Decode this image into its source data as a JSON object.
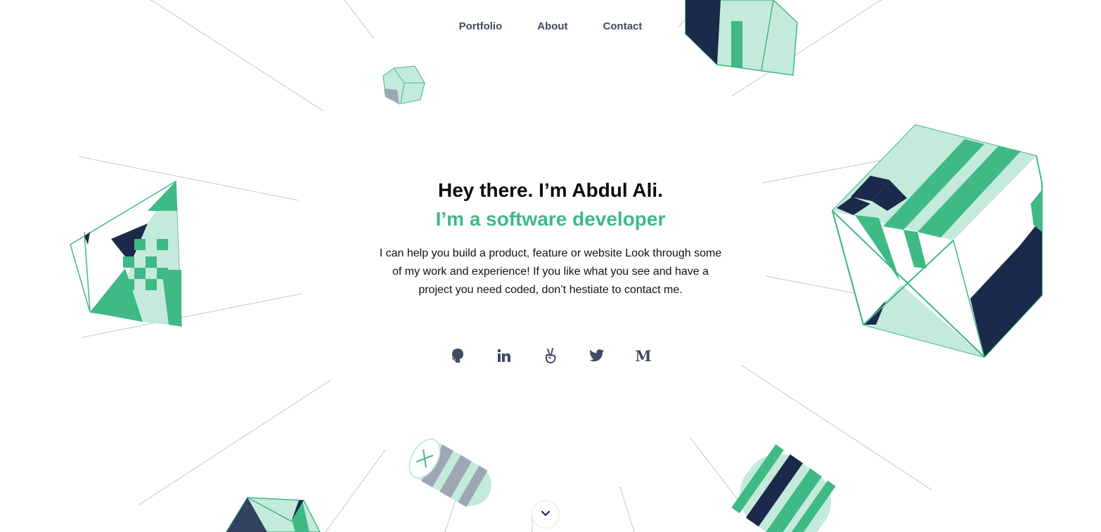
{
  "nav": {
    "items": [
      {
        "label": "Portfolio"
      },
      {
        "label": "About"
      },
      {
        "label": "Contact"
      }
    ]
  },
  "hero": {
    "greeting": "Hey there. I’m Abdul Ali.",
    "role": "I’m a software developer",
    "intro": "I can help you build a product, feature or website Look through some of my work and experience! If you like what you see and have a project you need coded, don’t hestiate to contact me."
  },
  "socials": [
    {
      "icon": "github-icon"
    },
    {
      "icon": "linkedin-icon"
    },
    {
      "icon": "angellist-icon"
    },
    {
      "icon": "twitter-icon"
    },
    {
      "icon": "medium-icon",
      "glyph": "M"
    }
  ],
  "scroll": {
    "icon": "chevron-down-icon"
  },
  "colors": {
    "accent": "#3fb985",
    "accent_light": "#c4eadb",
    "navy": "#1b2a4b",
    "slate": "#3f4b63",
    "text": "#0c0c0c"
  }
}
